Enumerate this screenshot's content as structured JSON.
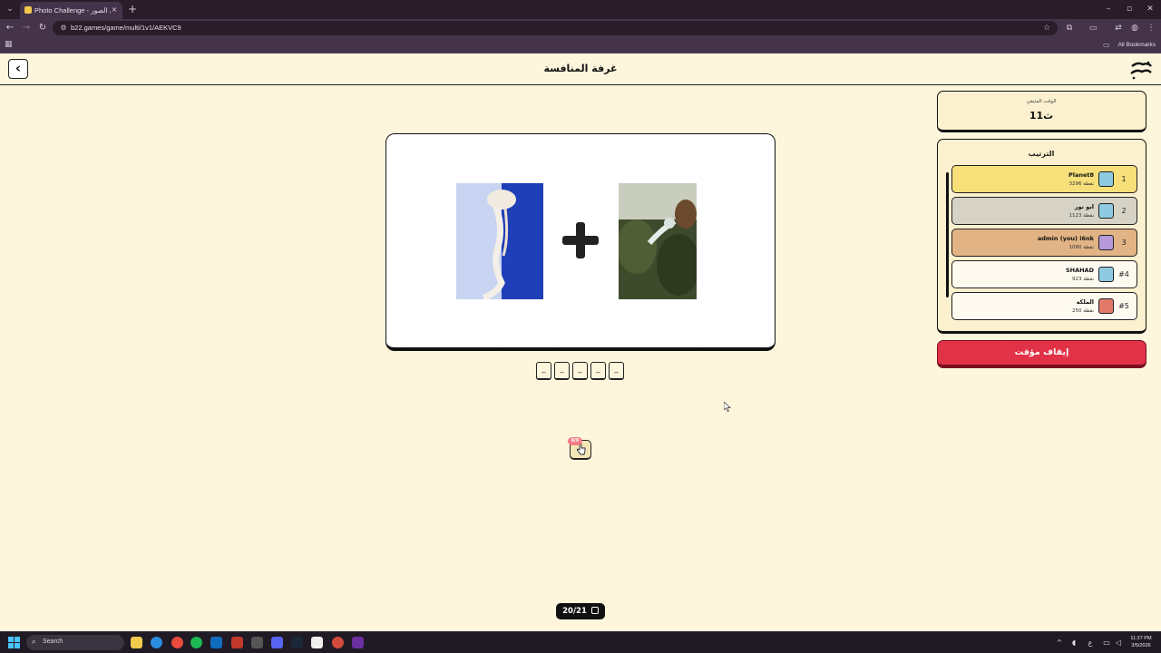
{
  "browser": {
    "tab_title": "Photo Challenge - تحدي الصور",
    "tab_close": "×",
    "new_tab": "+",
    "tab_menu": "⌄",
    "url": "b22.games/game/multi/1v1/AEKVC9",
    "all_bookmarks": "All Bookmarks",
    "window_controls": [
      "–",
      "▫",
      "✕"
    ]
  },
  "header": {
    "title": "غرفة المنافسة",
    "back_icon": "‹"
  },
  "puzzle": {
    "letters": [
      "_",
      "_",
      "_",
      "_",
      "_"
    ],
    "hint_badge": "0/0",
    "progress": "20/21"
  },
  "timer": {
    "label": "الوقت المتبقي",
    "value": "11ث"
  },
  "ranking": {
    "title": "الترتيب",
    "players": [
      {
        "rank": "1",
        "name": "Planet8",
        "points": "3296 نقطة",
        "color": "#f7e07a",
        "avatar_color": "#8ecbe0"
      },
      {
        "rank": "2",
        "name": "ابو نور",
        "points": "1123 نقطة",
        "color": "#d6d3c6",
        "avatar_color": "#8ecbe0"
      },
      {
        "rank": "3",
        "name": "admin (you) i6nk",
        "points": "1080 نقطة",
        "color": "#e2b485",
        "avatar_color": "#b79ad9"
      },
      {
        "rank": "#4",
        "name": "SHAHAD",
        "points": "923 نقطة",
        "color": "#fffaf0",
        "avatar_color": "#8ecbe0"
      },
      {
        "rank": "#5",
        "name": "الملكه",
        "points": "250 نقطة",
        "color": "#fffaf0",
        "avatar_color": "#e27a6a"
      }
    ]
  },
  "stop_button": "إيقاف مؤقت",
  "taskbar": {
    "search": "Search",
    "time": "11:27 PM",
    "date": "3/5/2026"
  }
}
